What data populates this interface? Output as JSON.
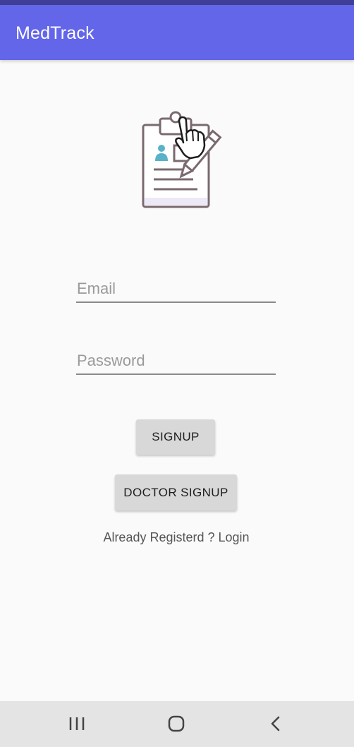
{
  "app": {
    "title": "MedTrack"
  },
  "colors": {
    "app_bar": "#6366e8",
    "status_strip": "#3f3f9a",
    "background": "#fafafa",
    "button": "#d8d8d8",
    "nav_bar": "#e4e4e4"
  },
  "logo": {
    "icon": "clipboard-pencil-icon"
  },
  "form": {
    "email_placeholder": "Email",
    "email_value": "",
    "password_placeholder": "Password",
    "password_value": ""
  },
  "buttons": {
    "signup_label": "SIGNUP",
    "doctor_signup_label": "DOCTOR SIGNUP"
  },
  "login_link": {
    "text": "Already Registerd ? Login"
  },
  "nav_bar": {
    "recent_icon": "recent-apps-icon",
    "home_icon": "home-icon",
    "back_icon": "back-icon"
  }
}
